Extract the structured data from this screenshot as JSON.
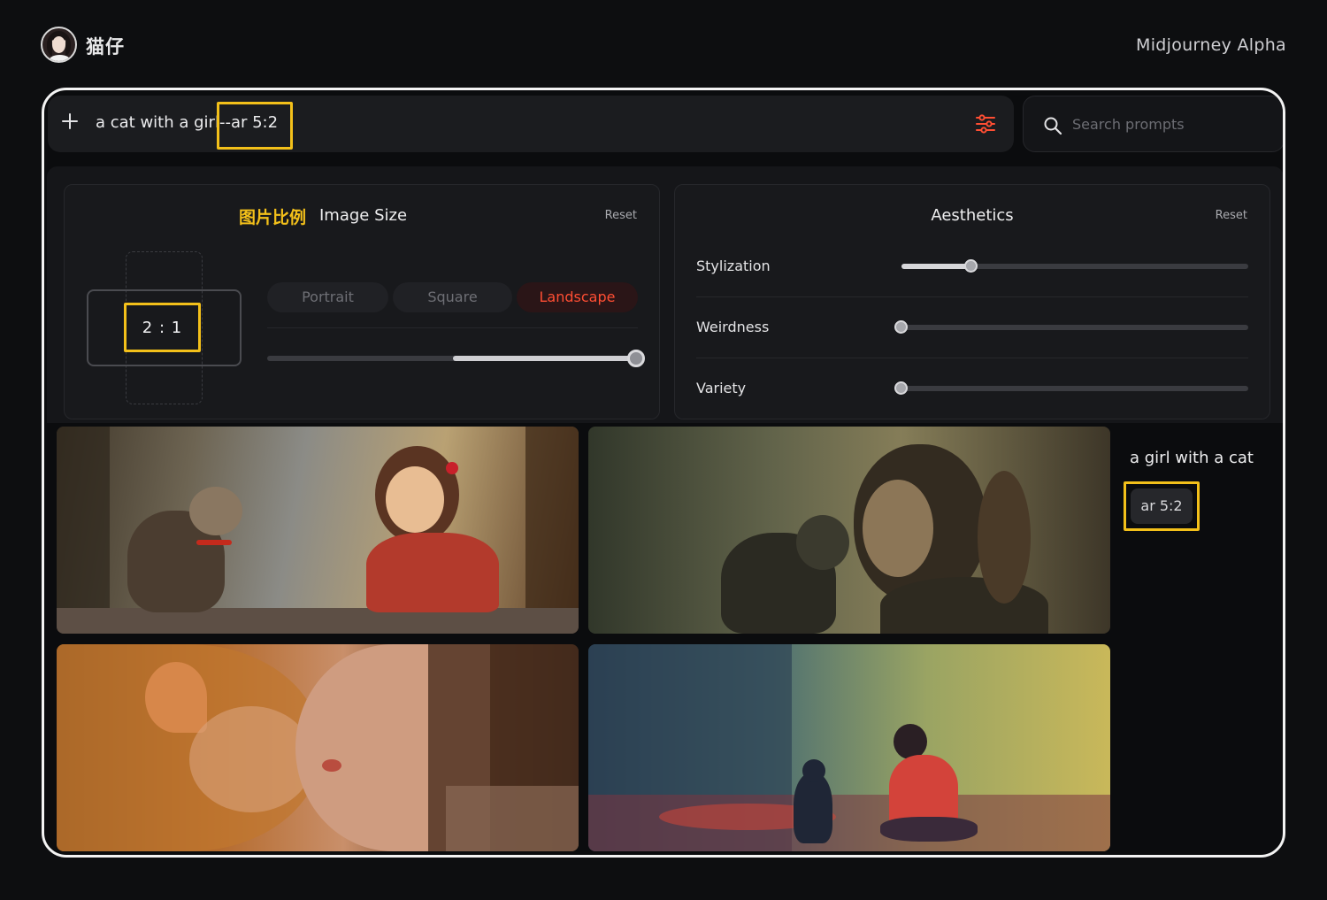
{
  "header": {
    "user_name": "猫仔",
    "app_title": "Midjourney Alpha"
  },
  "prompt": {
    "text": "a cat with a girl",
    "param": "--ar 5:2"
  },
  "search": {
    "placeholder": "Search prompts"
  },
  "image_size": {
    "title_cn": "图片比例",
    "title_en": "Image Size",
    "reset_label": "Reset",
    "ratio": "2 : 1",
    "orientation_options": [
      "Portrait",
      "Square",
      "Landscape"
    ],
    "selected": "Landscape",
    "slider_value": 1.0
  },
  "aesthetics": {
    "title": "Aesthetics",
    "reset_label": "Reset",
    "sliders": [
      {
        "label": "Stylization",
        "value": 0.2
      },
      {
        "label": "Weirdness",
        "value": 0.0
      },
      {
        "label": "Variety",
        "value": 0.0
      }
    ]
  },
  "result": {
    "caption": "a girl with a cat",
    "tag": "ar 5:2"
  },
  "colors": {
    "accent": "#ff4e33",
    "highlight": "#f3c01a",
    "background": "#0d0e10"
  }
}
